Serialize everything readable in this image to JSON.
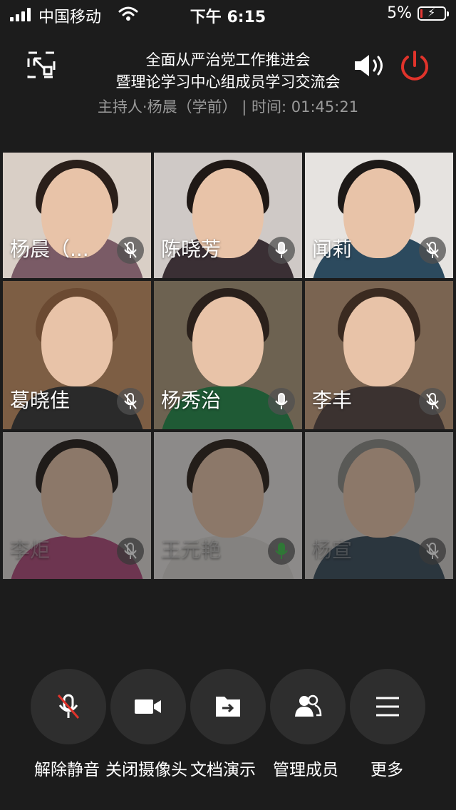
{
  "status_bar": {
    "carrier": "中国移动",
    "time": "下午 6:15",
    "battery_percent": "5%",
    "battery_level": 0.05,
    "battery_color": "#e53935",
    "icons": [
      "signal-icon",
      "wifi-icon",
      "battery-charging-icon"
    ]
  },
  "meeting": {
    "title_line1": "全面从严治党工作推进会",
    "title_line2": "暨理论学习中心组成员学习交流会",
    "host_info": "主持人·杨晨（学前） | 时间: 01:45:21"
  },
  "header_icons": {
    "minimize": "minimize-window-icon",
    "speaker": "speaker-icon",
    "leave": "power-icon",
    "leave_color": "#e0332b"
  },
  "participants": [
    {
      "name": "杨晨（...",
      "mic": "muted"
    },
    {
      "name": "陈晓芳",
      "mic": "unmuted"
    },
    {
      "name": "闻莉",
      "mic": "muted"
    },
    {
      "name": "葛晓佳",
      "mic": "muted"
    },
    {
      "name": "杨秀治",
      "mic": "unmuted"
    },
    {
      "name": "李丰",
      "mic": "muted"
    },
    {
      "name": "李炬",
      "mic": "muted"
    },
    {
      "name": "王元艳",
      "mic": "speaking",
      "mic_color": "#3ec24b"
    },
    {
      "name": "杨宣",
      "mic": "muted"
    }
  ],
  "controls": [
    {
      "label": "解除静音",
      "icon": "mic-muted-icon"
    },
    {
      "label": "关闭摄像头",
      "icon": "camera-icon"
    },
    {
      "label": "文档演示",
      "icon": "share-folder-icon"
    },
    {
      "label": "管理成员",
      "icon": "members-icon"
    },
    {
      "label": "更多",
      "icon": "menu-icon"
    }
  ]
}
